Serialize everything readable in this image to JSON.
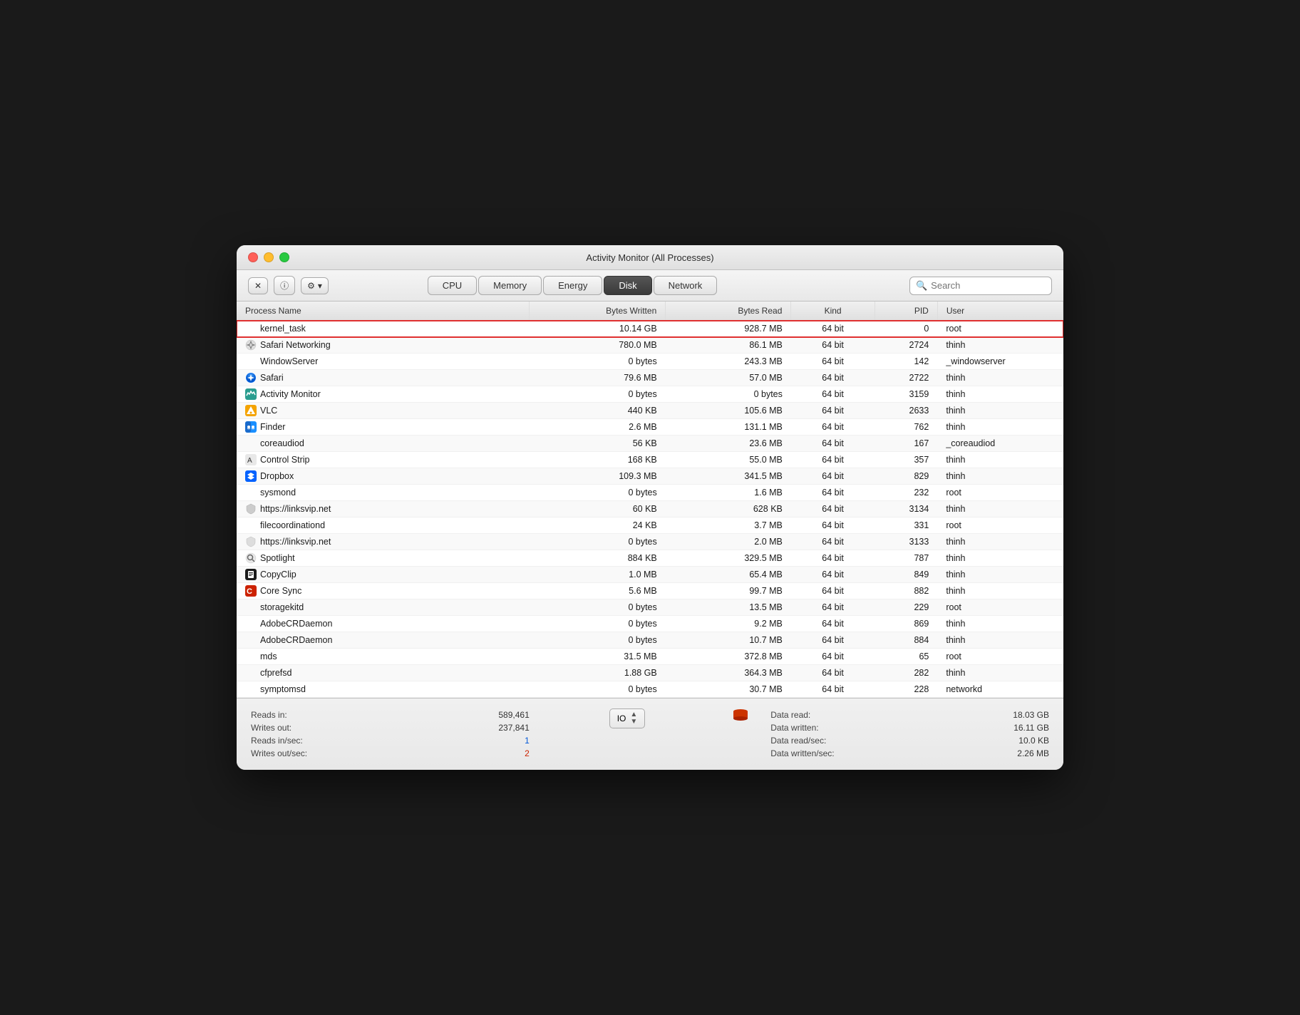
{
  "window": {
    "title": "Activity Monitor (All Processes)"
  },
  "toolbar": {
    "close_btn": "×",
    "info_btn": "i",
    "action_btn": "⚙ ▾",
    "search_placeholder": "Search"
  },
  "tabs": [
    {
      "id": "cpu",
      "label": "CPU",
      "active": false
    },
    {
      "id": "memory",
      "label": "Memory",
      "active": false
    },
    {
      "id": "energy",
      "label": "Energy",
      "active": false
    },
    {
      "id": "disk",
      "label": "Disk",
      "active": true
    },
    {
      "id": "network",
      "label": "Network",
      "active": false
    }
  ],
  "table": {
    "columns": [
      {
        "id": "process_name",
        "label": "Process Name"
      },
      {
        "id": "bytes_written",
        "label": "Bytes Written",
        "align": "right"
      },
      {
        "id": "bytes_read",
        "label": "Bytes Read",
        "align": "right"
      },
      {
        "id": "kind",
        "label": "Kind",
        "align": "center"
      },
      {
        "id": "pid",
        "label": "PID",
        "align": "right"
      },
      {
        "id": "user",
        "label": "User"
      }
    ],
    "rows": [
      {
        "name": "kernel_task",
        "icon": null,
        "bytes_written": "10.14 GB",
        "bytes_read": "928.7 MB",
        "kind": "64 bit",
        "pid": "0",
        "user": "root",
        "selected": true
      },
      {
        "name": "Safari Networking",
        "icon": "safari",
        "bytes_written": "780.0 MB",
        "bytes_read": "86.1 MB",
        "kind": "64 bit",
        "pid": "2724",
        "user": "thinh"
      },
      {
        "name": "WindowServer",
        "icon": null,
        "bytes_written": "0 bytes",
        "bytes_read": "243.3 MB",
        "kind": "64 bit",
        "pid": "142",
        "user": "_windowserver"
      },
      {
        "name": "Safari",
        "icon": "safari-full",
        "bytes_written": "79.6 MB",
        "bytes_read": "57.0 MB",
        "kind": "64 bit",
        "pid": "2722",
        "user": "thinh"
      },
      {
        "name": "Activity Monitor",
        "icon": "actmon",
        "bytes_written": "0 bytes",
        "bytes_read": "0 bytes",
        "kind": "64 bit",
        "pid": "3159",
        "user": "thinh"
      },
      {
        "name": "VLC",
        "icon": "vlc",
        "bytes_written": "440 KB",
        "bytes_read": "105.6 MB",
        "kind": "64 bit",
        "pid": "2633",
        "user": "thinh"
      },
      {
        "name": "Finder",
        "icon": "finder",
        "bytes_written": "2.6 MB",
        "bytes_read": "131.1 MB",
        "kind": "64 bit",
        "pid": "762",
        "user": "thinh"
      },
      {
        "name": "coreaudiod",
        "icon": null,
        "bytes_written": "56 KB",
        "bytes_read": "23.6 MB",
        "kind": "64 bit",
        "pid": "167",
        "user": "_coreaudiod"
      },
      {
        "name": "Control Strip",
        "icon": "control",
        "bytes_written": "168 KB",
        "bytes_read": "55.0 MB",
        "kind": "64 bit",
        "pid": "357",
        "user": "thinh"
      },
      {
        "name": "Dropbox",
        "icon": "dropbox",
        "bytes_written": "109.3 MB",
        "bytes_read": "341.5 MB",
        "kind": "64 bit",
        "pid": "829",
        "user": "thinh"
      },
      {
        "name": "sysmond",
        "icon": null,
        "bytes_written": "0 bytes",
        "bytes_read": "1.6 MB",
        "kind": "64 bit",
        "pid": "232",
        "user": "root"
      },
      {
        "name": "https://linksvip.net",
        "icon": "shield-gray",
        "bytes_written": "60 KB",
        "bytes_read": "628 KB",
        "kind": "64 bit",
        "pid": "3134",
        "user": "thinh"
      },
      {
        "name": "filecoordinationd",
        "icon": null,
        "bytes_written": "24 KB",
        "bytes_read": "3.7 MB",
        "kind": "64 bit",
        "pid": "331",
        "user": "root"
      },
      {
        "name": "https://linksvip.net",
        "icon": "shield-gray2",
        "bytes_written": "0 bytes",
        "bytes_read": "2.0 MB",
        "kind": "64 bit",
        "pid": "3133",
        "user": "thinh"
      },
      {
        "name": "Spotlight",
        "icon": "spotlight",
        "bytes_written": "884 KB",
        "bytes_read": "329.5 MB",
        "kind": "64 bit",
        "pid": "787",
        "user": "thinh"
      },
      {
        "name": "CopyClip",
        "icon": "copyclip",
        "bytes_written": "1.0 MB",
        "bytes_read": "65.4 MB",
        "kind": "64 bit",
        "pid": "849",
        "user": "thinh"
      },
      {
        "name": "Core Sync",
        "icon": "coresync",
        "bytes_written": "5.6 MB",
        "bytes_read": "99.7 MB",
        "kind": "64 bit",
        "pid": "882",
        "user": "thinh"
      },
      {
        "name": "storagekitd",
        "icon": null,
        "bytes_written": "0 bytes",
        "bytes_read": "13.5 MB",
        "kind": "64 bit",
        "pid": "229",
        "user": "root"
      },
      {
        "name": "AdobeCRDaemon",
        "icon": null,
        "bytes_written": "0 bytes",
        "bytes_read": "9.2 MB",
        "kind": "64 bit",
        "pid": "869",
        "user": "thinh"
      },
      {
        "name": "AdobeCRDaemon",
        "icon": null,
        "bytes_written": "0 bytes",
        "bytes_read": "10.7 MB",
        "kind": "64 bit",
        "pid": "884",
        "user": "thinh"
      },
      {
        "name": "mds",
        "icon": null,
        "bytes_written": "31.5 MB",
        "bytes_read": "372.8 MB",
        "kind": "64 bit",
        "pid": "65",
        "user": "root"
      },
      {
        "name": "cfprefsd",
        "icon": null,
        "bytes_written": "1.88 GB",
        "bytes_read": "364.3 MB",
        "kind": "64 bit",
        "pid": "282",
        "user": "thinh"
      },
      {
        "name": "symptomsd",
        "icon": null,
        "bytes_written": "0 bytes",
        "bytes_read": "30.7 MB",
        "kind": "64 bit",
        "pid": "228",
        "user": "networkd"
      }
    ]
  },
  "footer": {
    "left": {
      "reads_in_label": "Reads in:",
      "reads_in_value": "589,461",
      "writes_out_label": "Writes out:",
      "writes_out_value": "237,841",
      "reads_in_sec_label": "Reads in/sec:",
      "reads_in_sec_value": "1",
      "writes_out_sec_label": "Writes out/sec:",
      "writes_out_sec_value": "2"
    },
    "io_selector": "IO",
    "right": {
      "data_read_label": "Data read:",
      "data_read_value": "18.03 GB",
      "data_written_label": "Data written:",
      "data_written_value": "16.11 GB",
      "data_read_sec_label": "Data read/sec:",
      "data_read_sec_value": "10.0 KB",
      "data_written_sec_label": "Data written/sec:",
      "data_written_sec_value": "2.26 MB"
    }
  },
  "colors": {
    "active_tab_bg": "#444",
    "selected_row_border": "#e03030",
    "blue_value": "#0057d8",
    "red_value": "#cc2200"
  }
}
